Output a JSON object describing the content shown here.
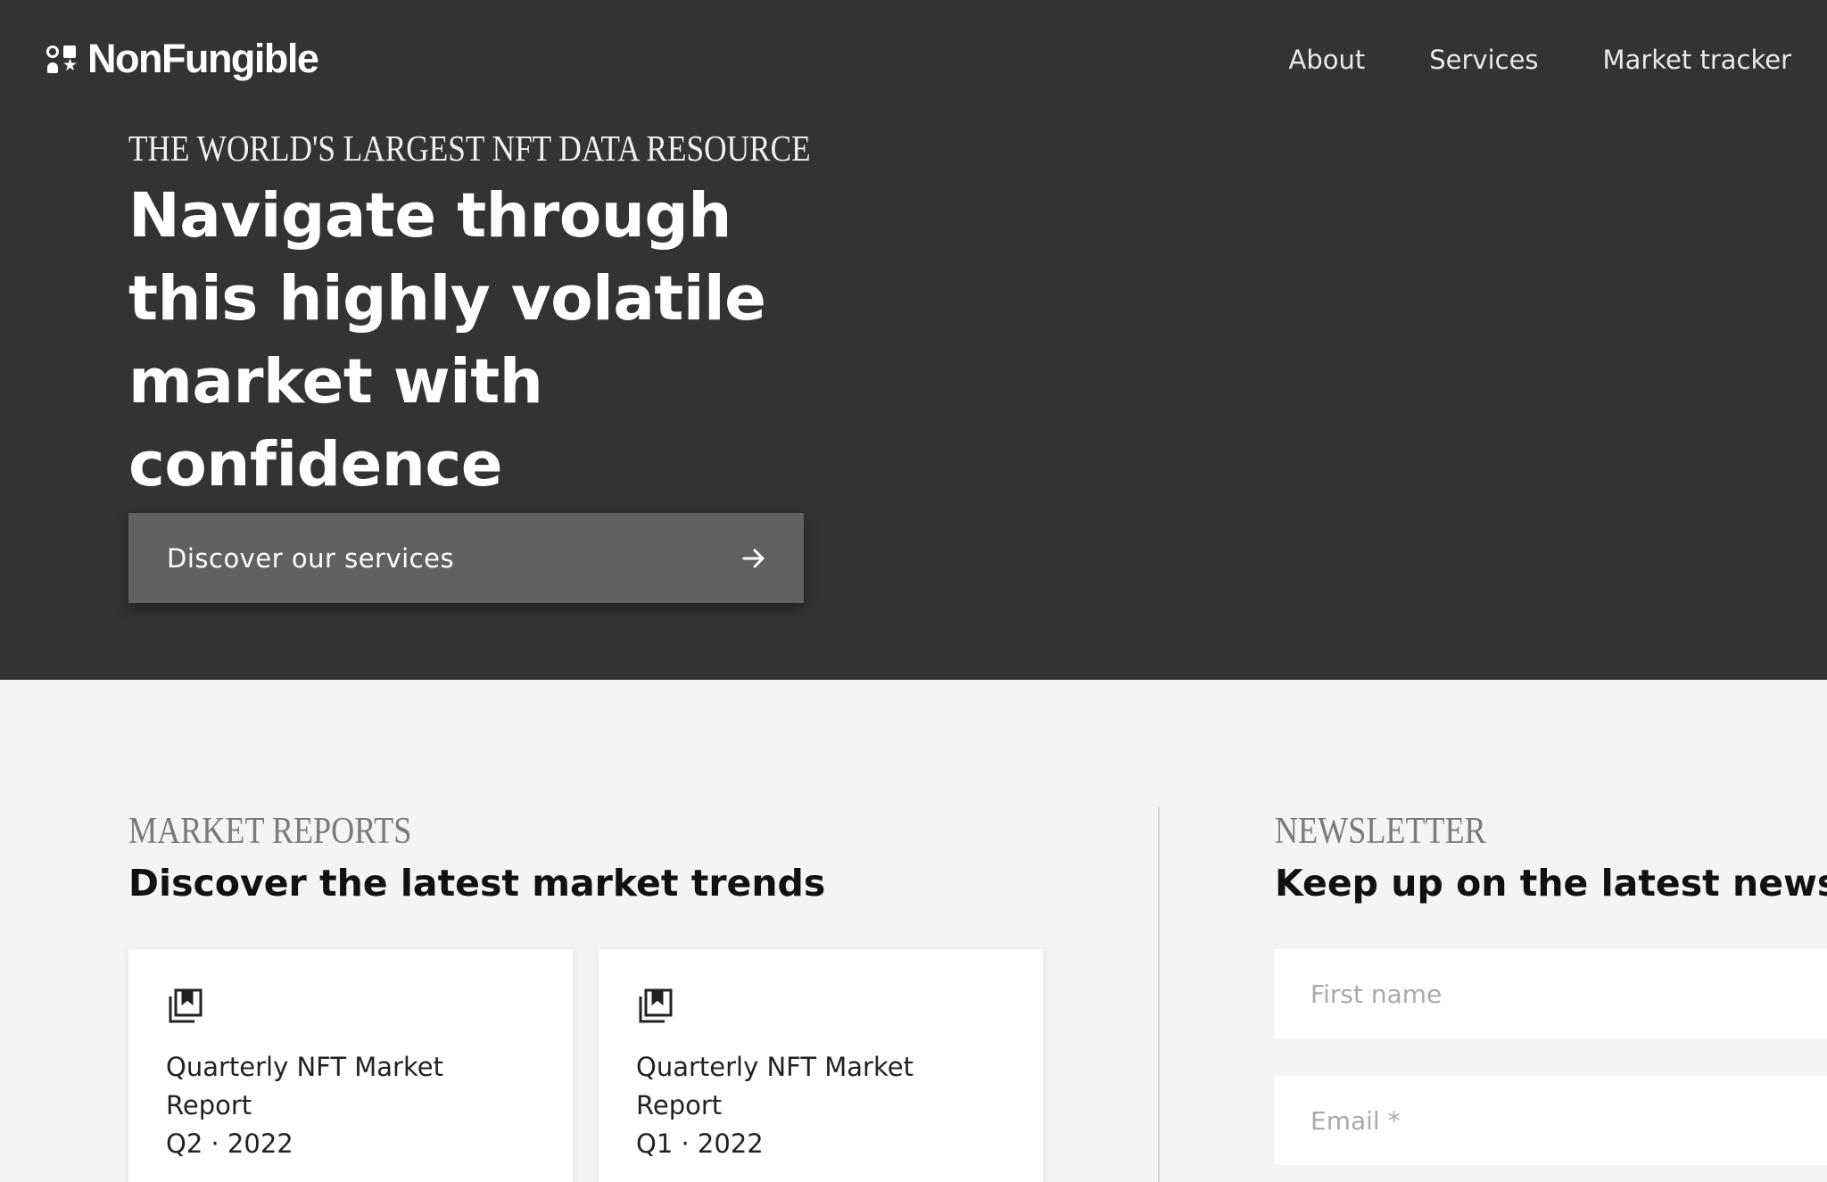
{
  "header": {
    "brand": "NonFungible",
    "nav": [
      {
        "label": "About"
      },
      {
        "label": "Services"
      },
      {
        "label": "Market tracker"
      }
    ]
  },
  "hero": {
    "eyebrow": "THE WORLD'S LARGEST NFT DATA RESOURCE",
    "headline": "Navigate through this highly volatile market with confidence",
    "cta_label": "Discover our services",
    "cta_icon": "arrow-right-icon"
  },
  "market_reports": {
    "eyebrow": "MARKET REPORTS",
    "title": "Discover the latest market trends",
    "cards": [
      {
        "icon": "report-bookmark-icon",
        "title": "Quarterly NFT Market Report",
        "period": "Q2 · 2022"
      },
      {
        "icon": "report-bookmark-icon",
        "title": "Quarterly NFT Market Report",
        "period": "Q1 · 2022"
      }
    ]
  },
  "newsletter": {
    "eyebrow": "NEWSLETTER",
    "title": "Keep up on the latest news in",
    "first_name_placeholder": "First name",
    "email_placeholder": "Email *"
  },
  "colors": {
    "hero_bg": "#333333",
    "cta_bg": "#616161",
    "page_bg": "#f3f4f3",
    "card_bg": "#ffffff"
  }
}
